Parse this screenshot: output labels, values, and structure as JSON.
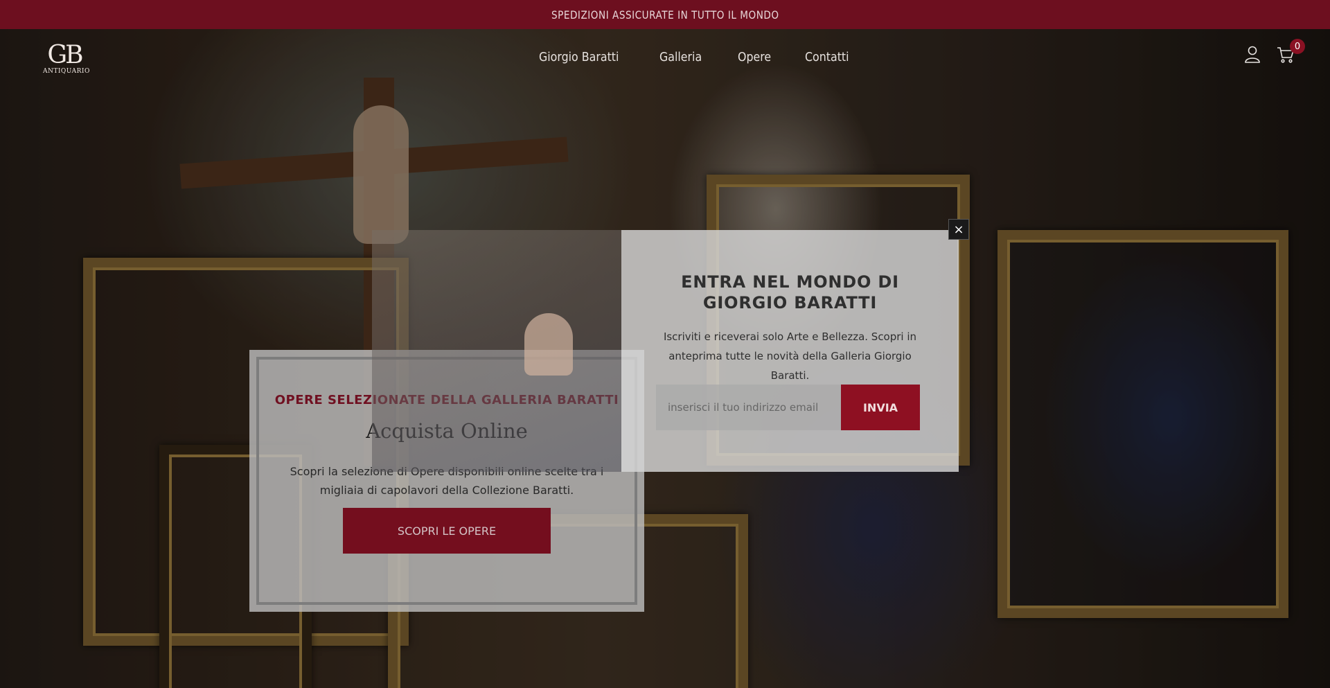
{
  "announcement": "SPEDIZIONI ASSICURATE IN TUTTO IL MONDO",
  "logo": {
    "monogram": "GB",
    "subtitle": "ANTIQUARIO"
  },
  "nav": [
    "Giorgio Baratti",
    "Galleria",
    "Opere",
    "Contatti"
  ],
  "header_icons": {
    "account": "user-icon",
    "cart": "cart-icon",
    "cart_count": "0"
  },
  "promo_card": {
    "eyebrow": "OPERE SELEZIONATE DELLA GALLERIA BARATTI",
    "title": "Acquista Online",
    "description": "Scopri la selezione di Opere disponibili online scelte tra i migliaia di capolavori della Collezione Baratti.",
    "cta_label": "SCOPRI LE OPERE"
  },
  "popup": {
    "close_label": "×",
    "heading": "ENTRA NEL MONDO DI GIORGIO BARATTI",
    "text": "Iscriviti e riceverai solo Arte e Bellezza. Scopri in anteprima tutte le novità della Galleria Giorgio Baratti.",
    "email_placeholder": "inserisci il tuo indirizzo email",
    "submit_label": "INVIA"
  },
  "colors": {
    "brand": "#6d0f1f",
    "button": "#8e1022"
  }
}
